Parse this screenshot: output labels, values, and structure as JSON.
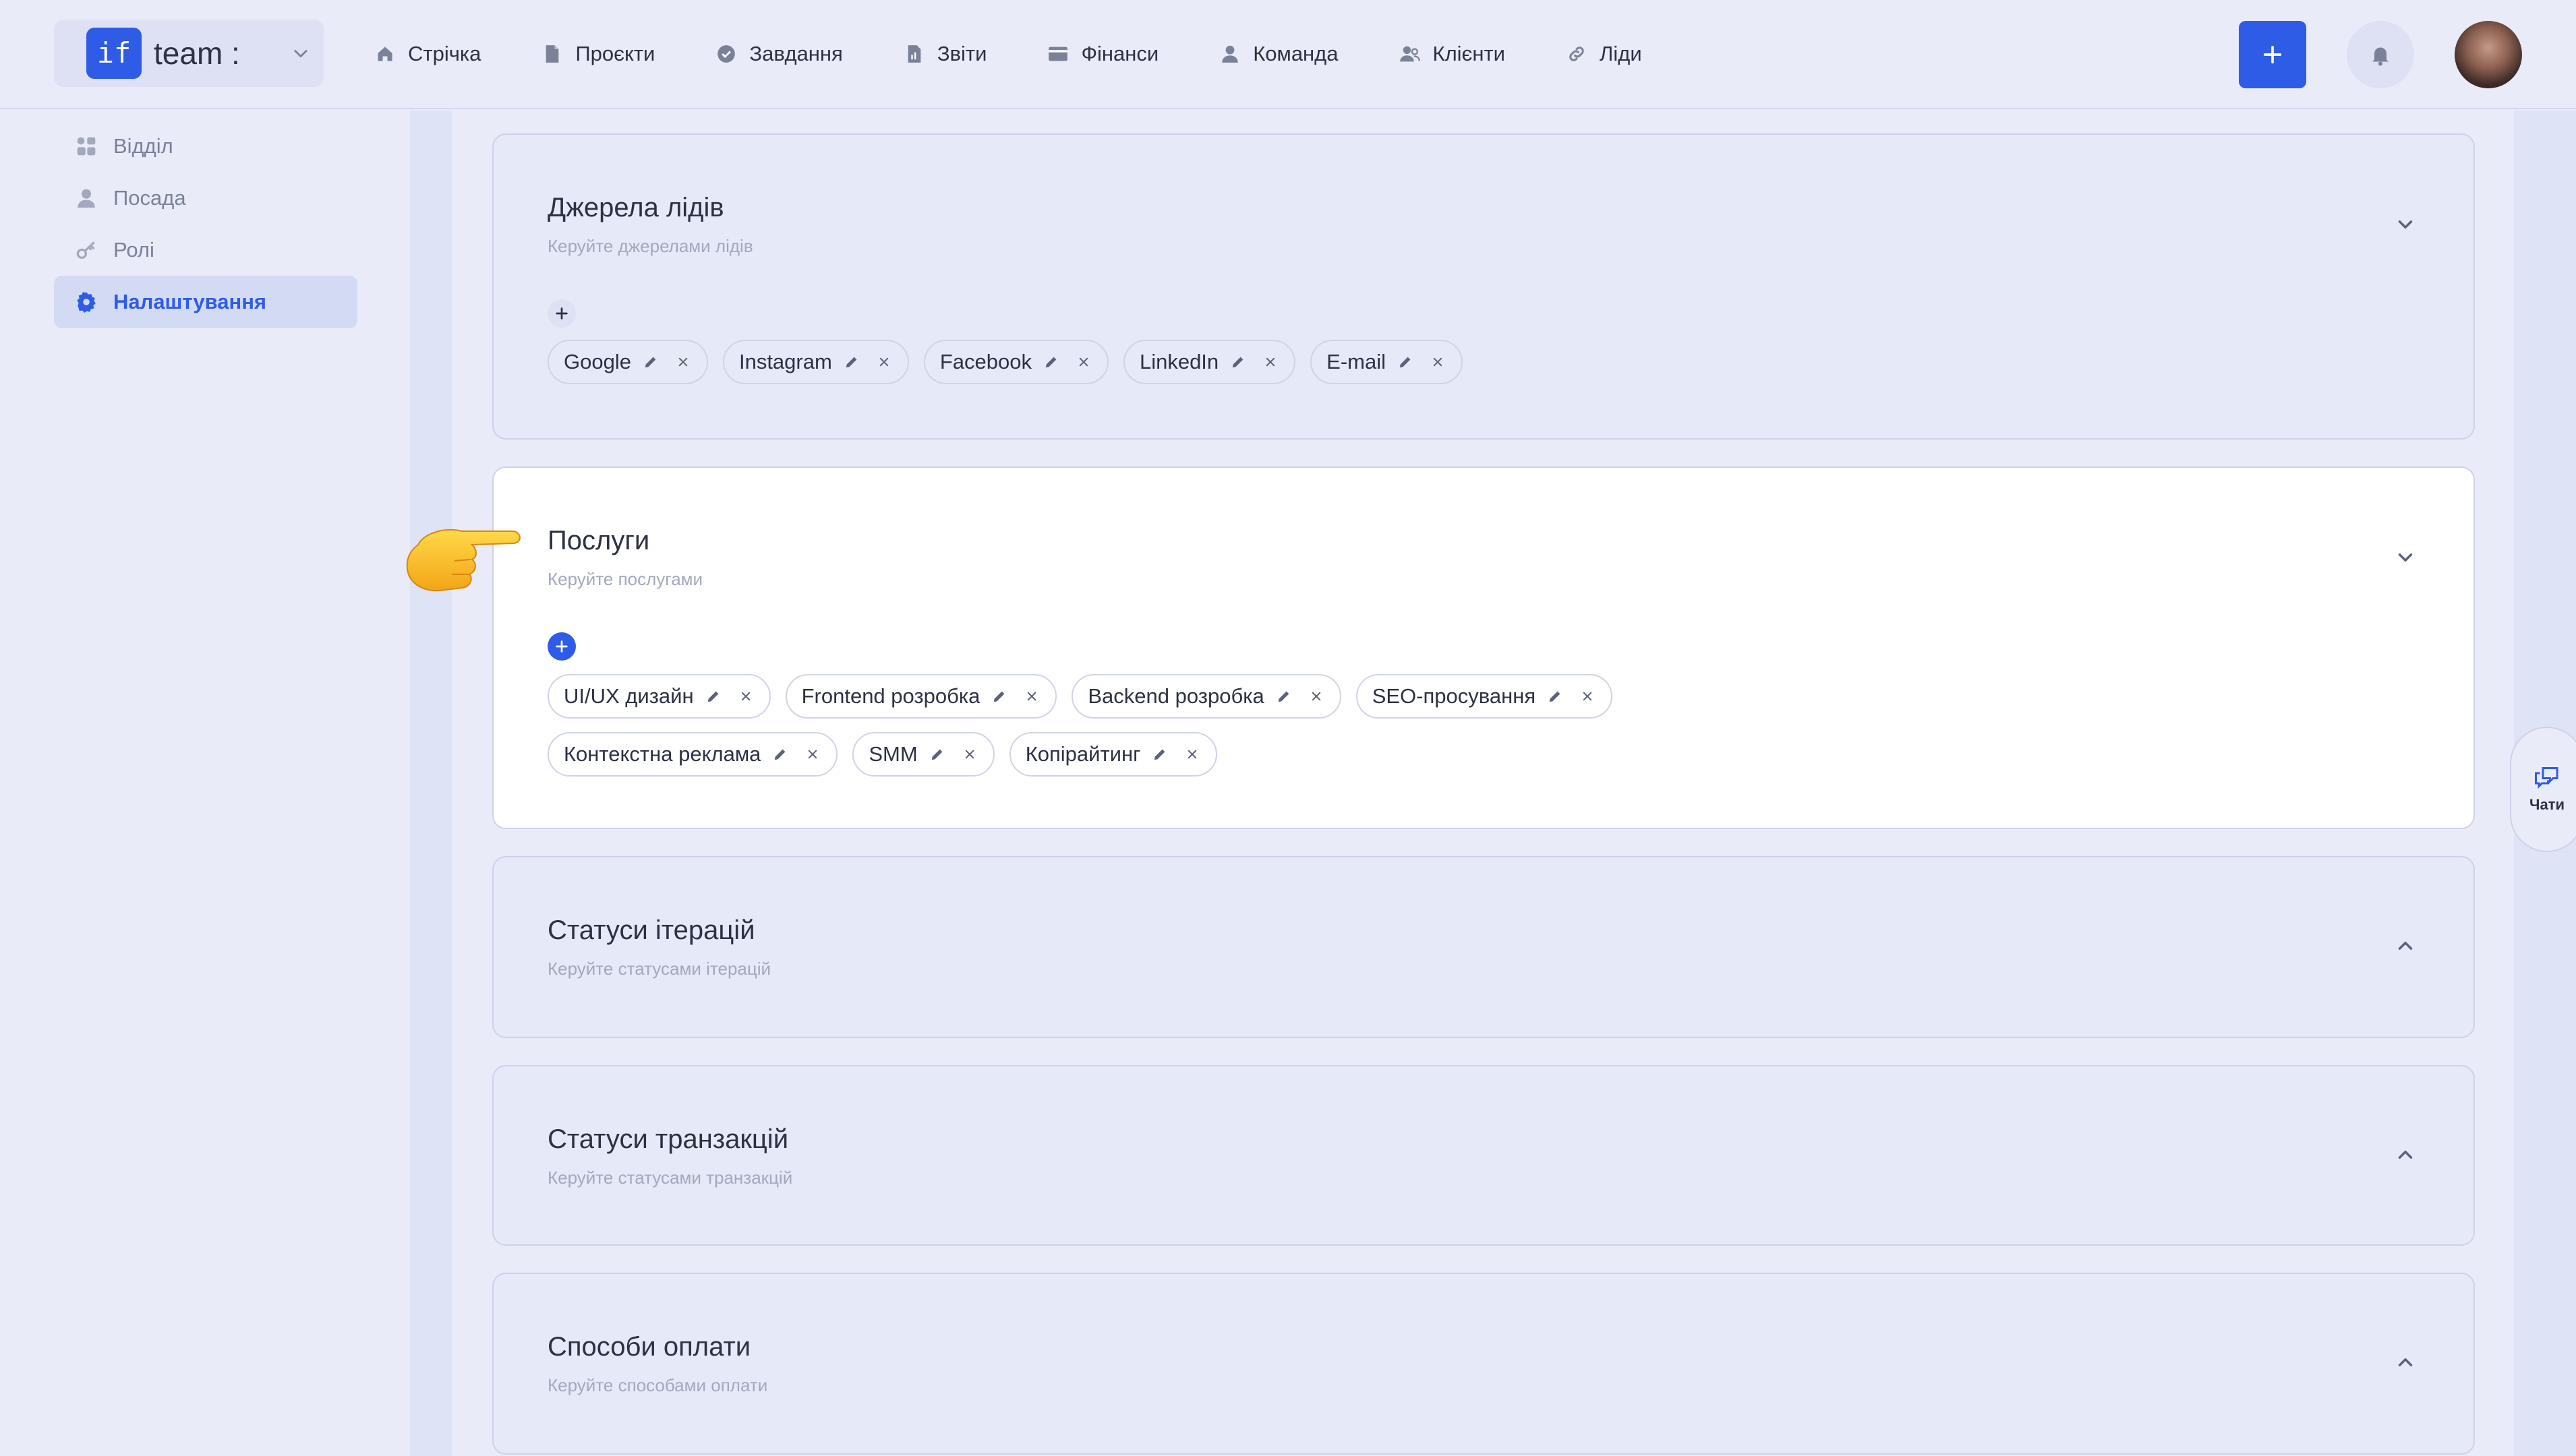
{
  "brand": {
    "logo_text": "if",
    "name": "team :"
  },
  "nav": [
    {
      "label": "Стрічка",
      "icon": "home-icon"
    },
    {
      "label": "Проєкти",
      "icon": "document-icon"
    },
    {
      "label": "Завдання",
      "icon": "check-circle-icon"
    },
    {
      "label": "Звіти",
      "icon": "report-icon"
    },
    {
      "label": "Фінанси",
      "icon": "wallet-icon"
    },
    {
      "label": "Команда",
      "icon": "user-icon"
    },
    {
      "label": "Клієнти",
      "icon": "users-icon"
    },
    {
      "label": "Ліди",
      "icon": "link-icon"
    }
  ],
  "sidebar": {
    "items": [
      {
        "label": "Відділ",
        "icon": "grid-icon",
        "active": false
      },
      {
        "label": "Посада",
        "icon": "user-icon",
        "active": false
      },
      {
        "label": "Ролі",
        "icon": "key-icon",
        "active": false
      },
      {
        "label": "Налаштування",
        "icon": "gear-icon",
        "active": true
      }
    ]
  },
  "sections": [
    {
      "title": "Джерела лідів",
      "subtitle": "Керуйте джерелами лідів",
      "expanded": true,
      "tags": [
        "Google",
        "Instagram",
        "Facebook",
        "LinkedIn",
        "E-mail"
      ]
    },
    {
      "title": "Послуги",
      "subtitle": "Керуйте послугами",
      "expanded": true,
      "tags_row1": [
        "UI/UX дизайн",
        "Frontend розробка",
        "Backend розробка",
        "SEO-просування"
      ],
      "tags_row2": [
        "Контекстна реклама",
        "SMM",
        "Копірайтинг"
      ]
    },
    {
      "title": "Статуси ітерацій",
      "subtitle": "Керуйте статусами ітерацій",
      "expanded": false
    },
    {
      "title": "Статуси транзакцій",
      "subtitle": "Керуйте статусами транзакцій",
      "expanded": false
    },
    {
      "title": "Способи оплати",
      "subtitle": "Керуйте способами оплати",
      "expanded": false
    }
  ],
  "chats": {
    "label": "Чати"
  },
  "colors": {
    "accent": "#2e5ce6",
    "background": "#e9ebf8",
    "card_active": "#ffffff"
  }
}
